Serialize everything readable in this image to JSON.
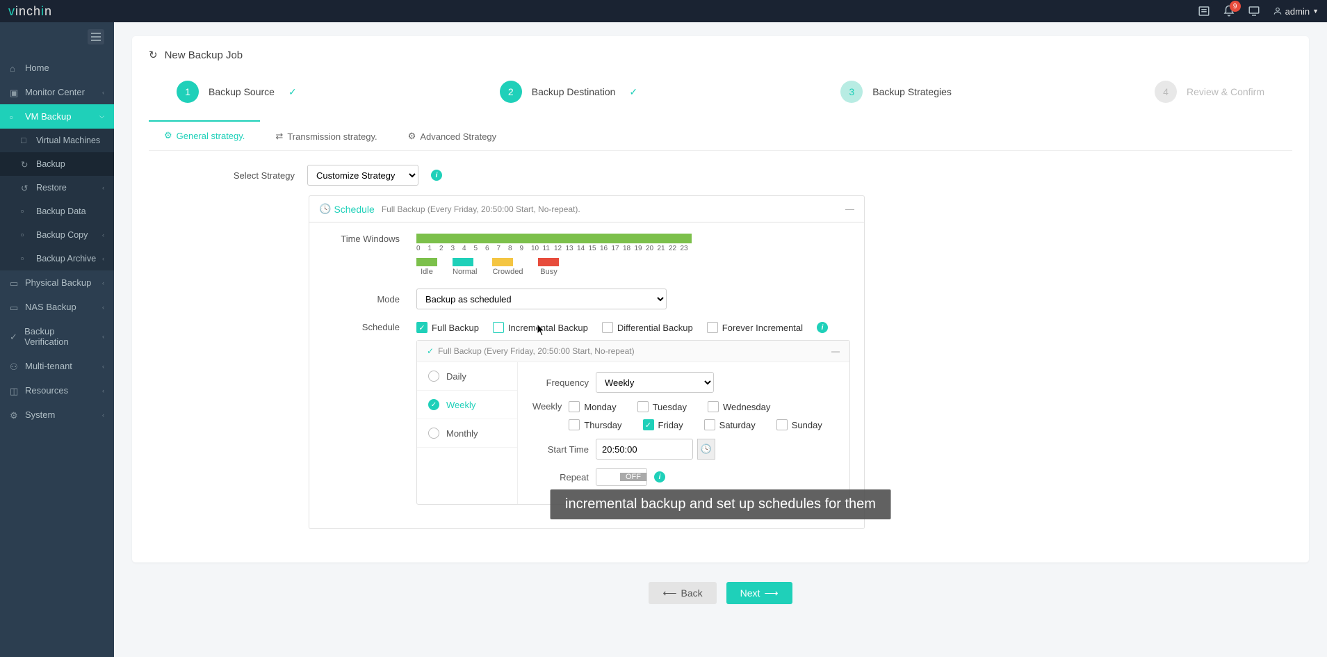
{
  "topbar": {
    "logo": "vinchin",
    "notif_count": "9",
    "user_label": "admin"
  },
  "sidebar": {
    "items": [
      {
        "label": "Home"
      },
      {
        "label": "Monitor Center"
      },
      {
        "label": "VM Backup"
      },
      {
        "label": "Physical Backup"
      },
      {
        "label": "NAS Backup"
      },
      {
        "label": "Backup Verification"
      },
      {
        "label": "Multi-tenant"
      },
      {
        "label": "Resources"
      },
      {
        "label": "System"
      }
    ],
    "vm_sub": [
      {
        "label": "Virtual Machines"
      },
      {
        "label": "Backup"
      },
      {
        "label": "Restore"
      },
      {
        "label": "Backup Data"
      },
      {
        "label": "Backup Copy"
      },
      {
        "label": "Backup Archive"
      }
    ]
  },
  "page": {
    "title": "New Backup Job"
  },
  "stepper": {
    "s1": {
      "num": "1",
      "label": "Backup Source"
    },
    "s2": {
      "num": "2",
      "label": "Backup Destination"
    },
    "s3": {
      "num": "3",
      "label": "Backup Strategies"
    },
    "s4": {
      "num": "4",
      "label": "Review & Confirm"
    }
  },
  "tabs": {
    "general": "General strategy.",
    "transmission": "Transmission strategy.",
    "advanced": "Advanced Strategy"
  },
  "form": {
    "select_strategy": "Select Strategy",
    "strategy_value": "Customize Strategy",
    "schedule_title": "Schedule",
    "schedule_desc": "Full Backup (Every Friday, 20:50:00 Start, No-repeat).",
    "time_windows": "Time Windows",
    "hours": [
      "0",
      "1",
      "2",
      "3",
      "4",
      "5",
      "6",
      "7",
      "8",
      "9",
      "10",
      "11",
      "12",
      "13",
      "14",
      "15",
      "16",
      "17",
      "18",
      "19",
      "20",
      "21",
      "22",
      "23"
    ],
    "legend": {
      "idle": "Idle",
      "normal": "Normal",
      "crowded": "Crowded",
      "busy": "Busy"
    },
    "mode_label": "Mode",
    "mode_value": "Backup as scheduled",
    "schedule_label": "Schedule",
    "full_backup": "Full Backup",
    "incremental": "Incremental Backup",
    "differential": "Differential Backup",
    "forever_inc": "Forever Incremental",
    "detail_hdr": "Full Backup (Every Friday, 20:50:00 Start, No-repeat)",
    "daily": "Daily",
    "weekly": "Weekly",
    "monthly": "Monthly",
    "frequency_label": "Frequency",
    "frequency_value": "Weekly",
    "weekly_label": "Weekly",
    "days": {
      "mon": "Monday",
      "tue": "Tuesday",
      "wed": "Wednesday",
      "thu": "Thursday",
      "fri": "Friday",
      "sat": "Saturday",
      "sun": "Sunday"
    },
    "start_time_label": "Start Time",
    "start_time_value": "20:50:00",
    "repeat_label": "Repeat",
    "repeat_off": "OFF"
  },
  "buttons": {
    "back": "Back",
    "next": "Next"
  },
  "caption": "incremental backup and set up schedules for them"
}
